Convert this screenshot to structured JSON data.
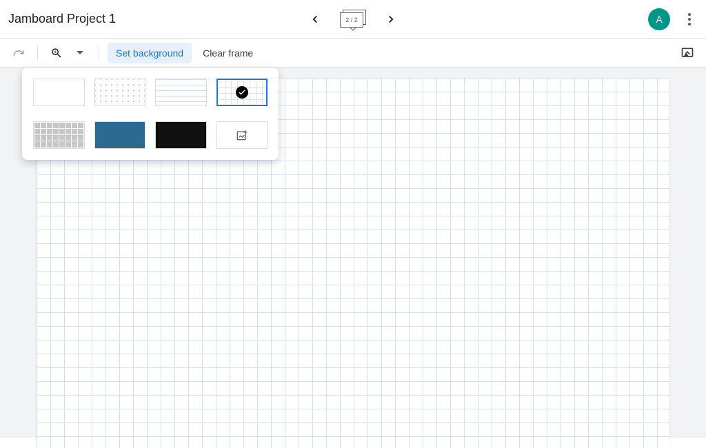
{
  "header": {
    "title": "Jamboard Project 1",
    "frame_counter": "2 / 2",
    "avatar_initial": "A"
  },
  "toolbar": {
    "set_background_label": "Set background",
    "clear_frame_label": "Clear frame"
  },
  "background_options": {
    "blank": "blank",
    "dots": "dots",
    "lines": "lines",
    "grid": "grid",
    "gray_grid": "gray-grid",
    "blue": "blue",
    "black": "black",
    "upload": "upload-image",
    "selected": "grid"
  },
  "icons": {
    "prev": "chevron-left",
    "next": "chevron-right",
    "redo": "redo",
    "zoom": "zoom-in",
    "dropdown": "caret-down",
    "cast": "cast",
    "menu": "more-vert",
    "upload": "add-image",
    "check": "check"
  }
}
